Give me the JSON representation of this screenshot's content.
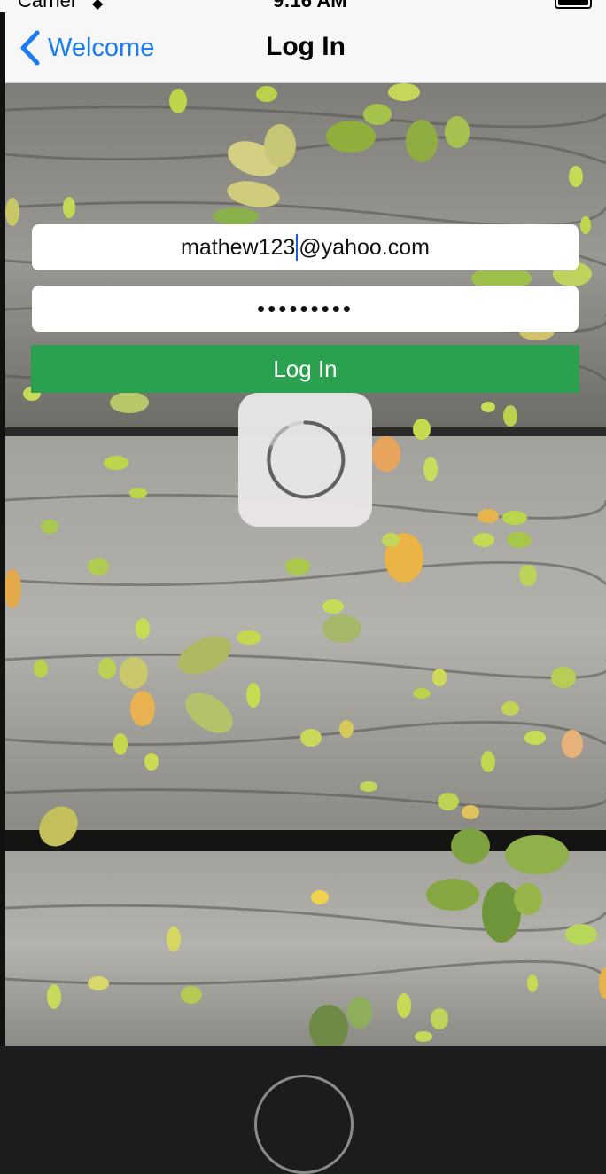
{
  "status_bar": {
    "carrier": "Carrier",
    "time": "9:16 AM",
    "wifi_icon": "wifi-icon",
    "battery_icon": "battery-icon"
  },
  "nav": {
    "back_label": "Welcome",
    "back_icon": "chevron-left-icon",
    "title": "Log In"
  },
  "form": {
    "email_value_before_caret": "mathew123",
    "email_value_after_caret": "@yahoo.com",
    "password_masked": "•••••••••",
    "login_button_label": "Log In"
  },
  "loading": {
    "icon": "activity-spinner-icon"
  },
  "colors": {
    "accent": "#1a7cf5",
    "login_button": "#2aa14f",
    "nav_background": "#f7f7f7"
  }
}
